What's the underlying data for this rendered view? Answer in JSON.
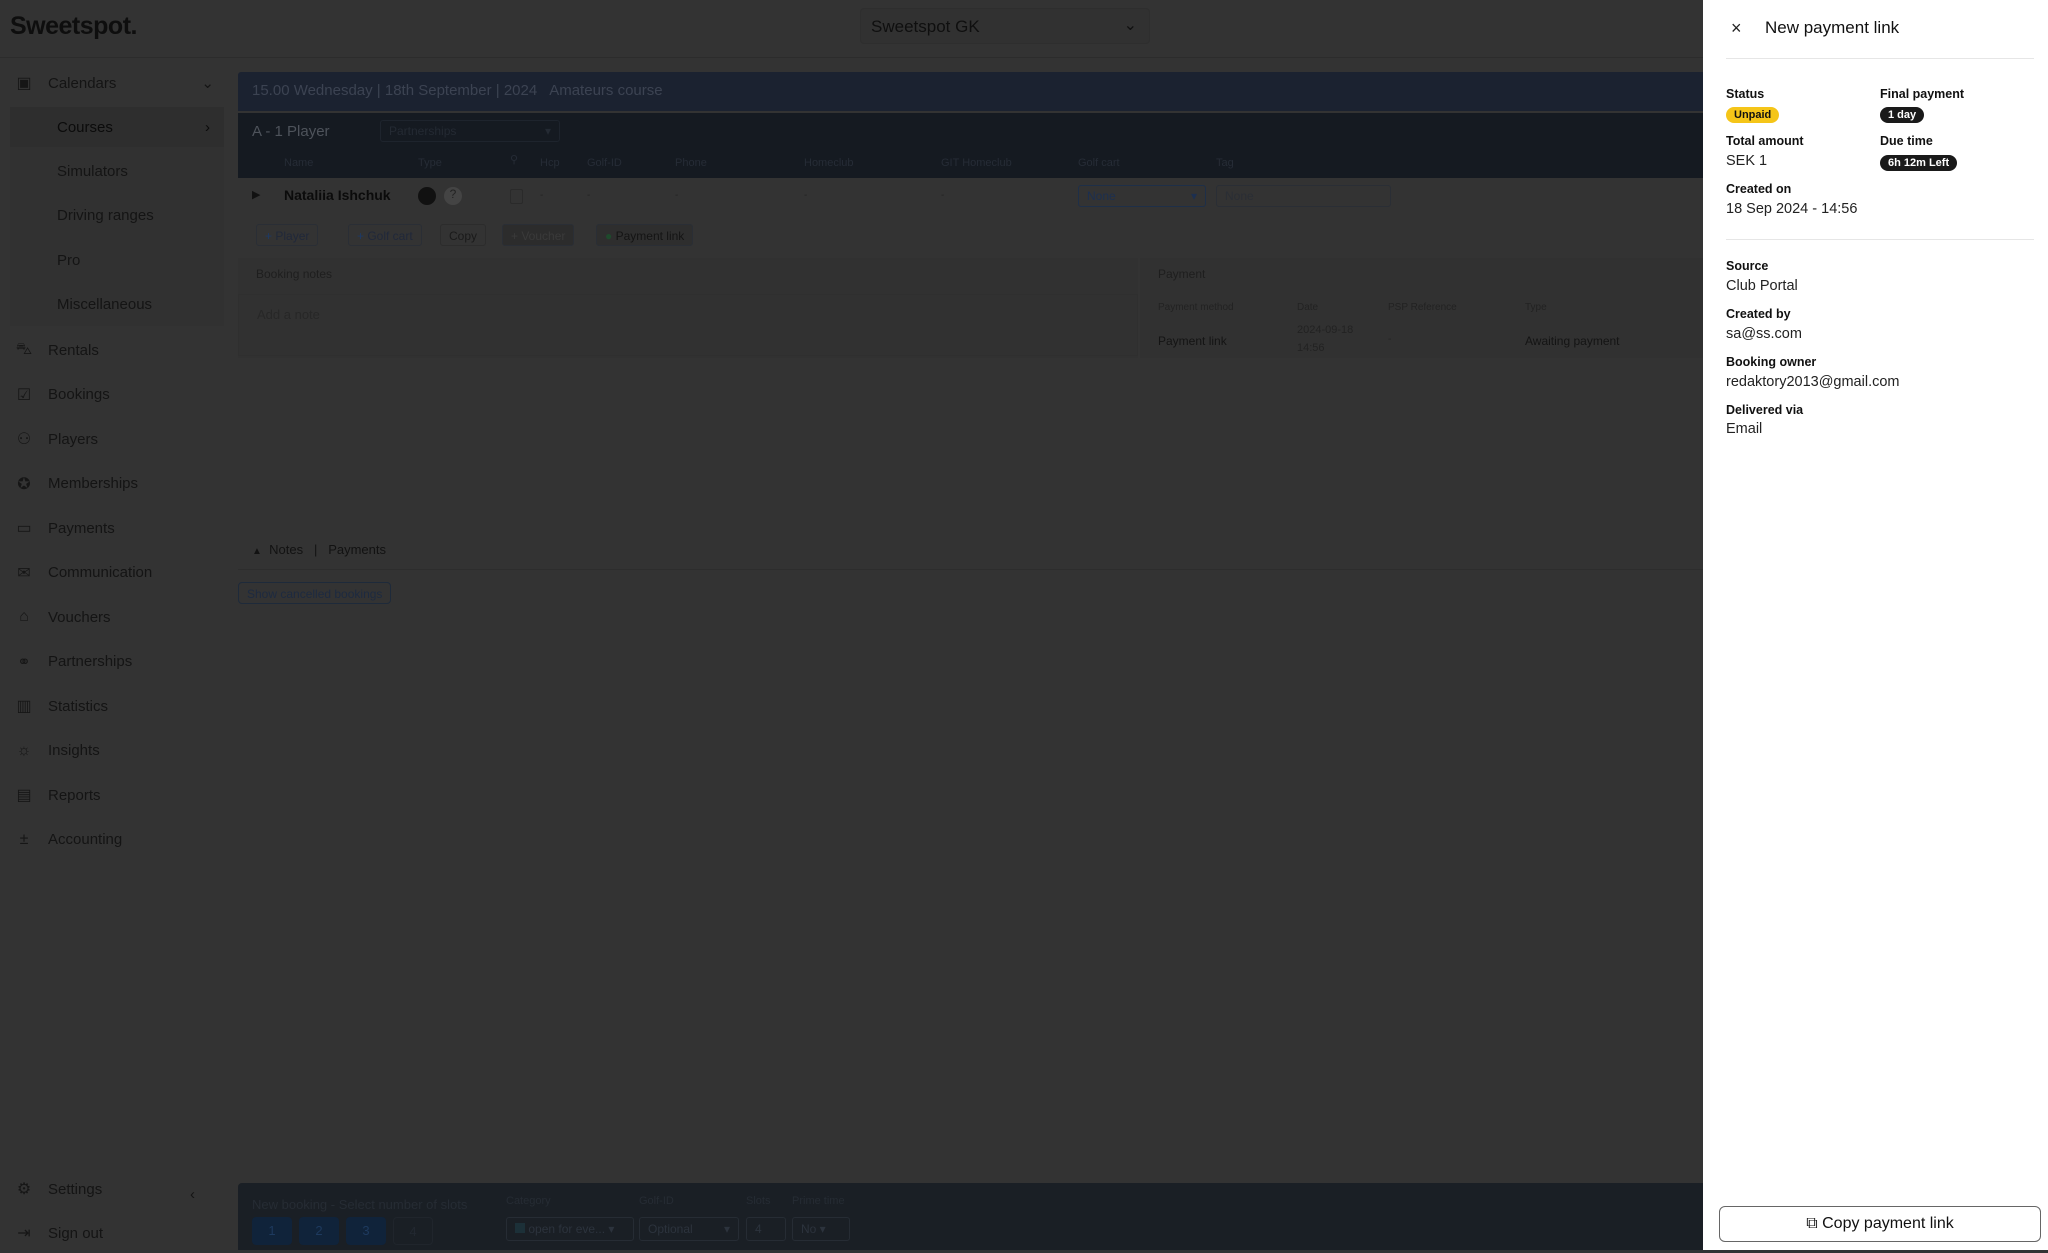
{
  "app": {
    "logo": "Sweetspot.",
    "club": "Sweetspot GK"
  },
  "sidebar": {
    "items": [
      {
        "label": "Calendars",
        "icon": "calendar-icon"
      },
      {
        "label": "Courses"
      },
      {
        "label": "Simulators"
      },
      {
        "label": "Driving ranges"
      },
      {
        "label": "Pro"
      },
      {
        "label": "Miscellaneous"
      },
      {
        "label": "Rentals",
        "icon": "golf-cart-icon"
      },
      {
        "label": "Bookings",
        "icon": "calendar-check-icon"
      },
      {
        "label": "Players",
        "icon": "users-icon"
      },
      {
        "label": "Memberships",
        "icon": "badge-check-icon"
      },
      {
        "label": "Payments",
        "icon": "cash-icon"
      },
      {
        "label": "Communication",
        "icon": "mail-icon"
      },
      {
        "label": "Vouchers",
        "icon": "gift-icon"
      },
      {
        "label": "Partnerships",
        "icon": "handshake-icon"
      },
      {
        "label": "Statistics",
        "icon": "bar-chart-icon"
      },
      {
        "label": "Insights",
        "icon": "lightbulb-icon"
      },
      {
        "label": "Reports",
        "icon": "report-icon"
      },
      {
        "label": "Accounting",
        "icon": "calculator-icon"
      }
    ],
    "settings": "Settings",
    "signout": "Sign out"
  },
  "booking": {
    "header_time": "15.00 Wednesday | 18th September | 2024",
    "header_course": "Amateurs course",
    "player_section": "A - 1 Player",
    "partnerships_placeholder": "Partnerships",
    "columns": [
      "Name",
      "Type",
      "Hcp",
      "Golf-ID",
      "Phone",
      "Homeclub",
      "GIT Homeclub",
      "Golf cart",
      "Tag"
    ],
    "player": {
      "name": "Nataliia Ishchuk",
      "hcp": "-",
      "golf_id": "-",
      "phone": "-",
      "homeclub": "-",
      "git_homeclub": "-",
      "golf_cart": "None",
      "tag_placeholder": "None"
    },
    "buttons": {
      "player": "Player",
      "golf_cart": "Golf cart",
      "copy": "Copy",
      "voucher": "Voucher",
      "payment_link": "Payment link"
    },
    "notes_title": "Booking notes",
    "notes_placeholder": "Add a note",
    "payment_title": "Payment",
    "payment_columns": [
      "Payment method",
      "Date",
      "PSP Reference",
      "Type"
    ],
    "payment_row": {
      "method": "Payment link",
      "date": "2024-09-18",
      "time": "14:56",
      "psp": "-",
      "type": "Awaiting payment"
    },
    "tabs": {
      "notes": "Notes",
      "sep": "|",
      "payments": "Payments"
    },
    "show_cancelled": "Show cancelled bookings"
  },
  "new_booking": {
    "title": "New booking - Select number of slots",
    "slots": [
      "1",
      "2",
      "3",
      "4"
    ],
    "category_label": "Category",
    "category_value": "open for eve...",
    "golfid_label": "Golf-ID",
    "golfid_value": "Optional",
    "slots_label": "Slots",
    "slots_value": "4",
    "prime_label": "Prime time",
    "prime_value": "No"
  },
  "drawer": {
    "title": "New payment link",
    "status_label": "Status",
    "status_value": "Unpaid",
    "final_label": "Final payment",
    "final_value": "1 day",
    "total_label": "Total amount",
    "total_value": "SEK 1",
    "due_label": "Due time",
    "due_value": "6h 12m Left",
    "created_on_label": "Created on",
    "created_on_value": "18 Sep 2024 - 14:56",
    "source_label": "Source",
    "source_value": "Club Portal",
    "created_by_label": "Created by",
    "created_by_value": "sa@ss.com",
    "owner_label": "Booking owner",
    "owner_value": "redaktory2013@gmail.com",
    "delivered_label": "Delivered via",
    "delivered_value": "Email",
    "copy_button": "Copy payment link"
  },
  "colors": {
    "unpaid_badge": "#f5c518",
    "dark_badge": "#1a1a1a"
  }
}
